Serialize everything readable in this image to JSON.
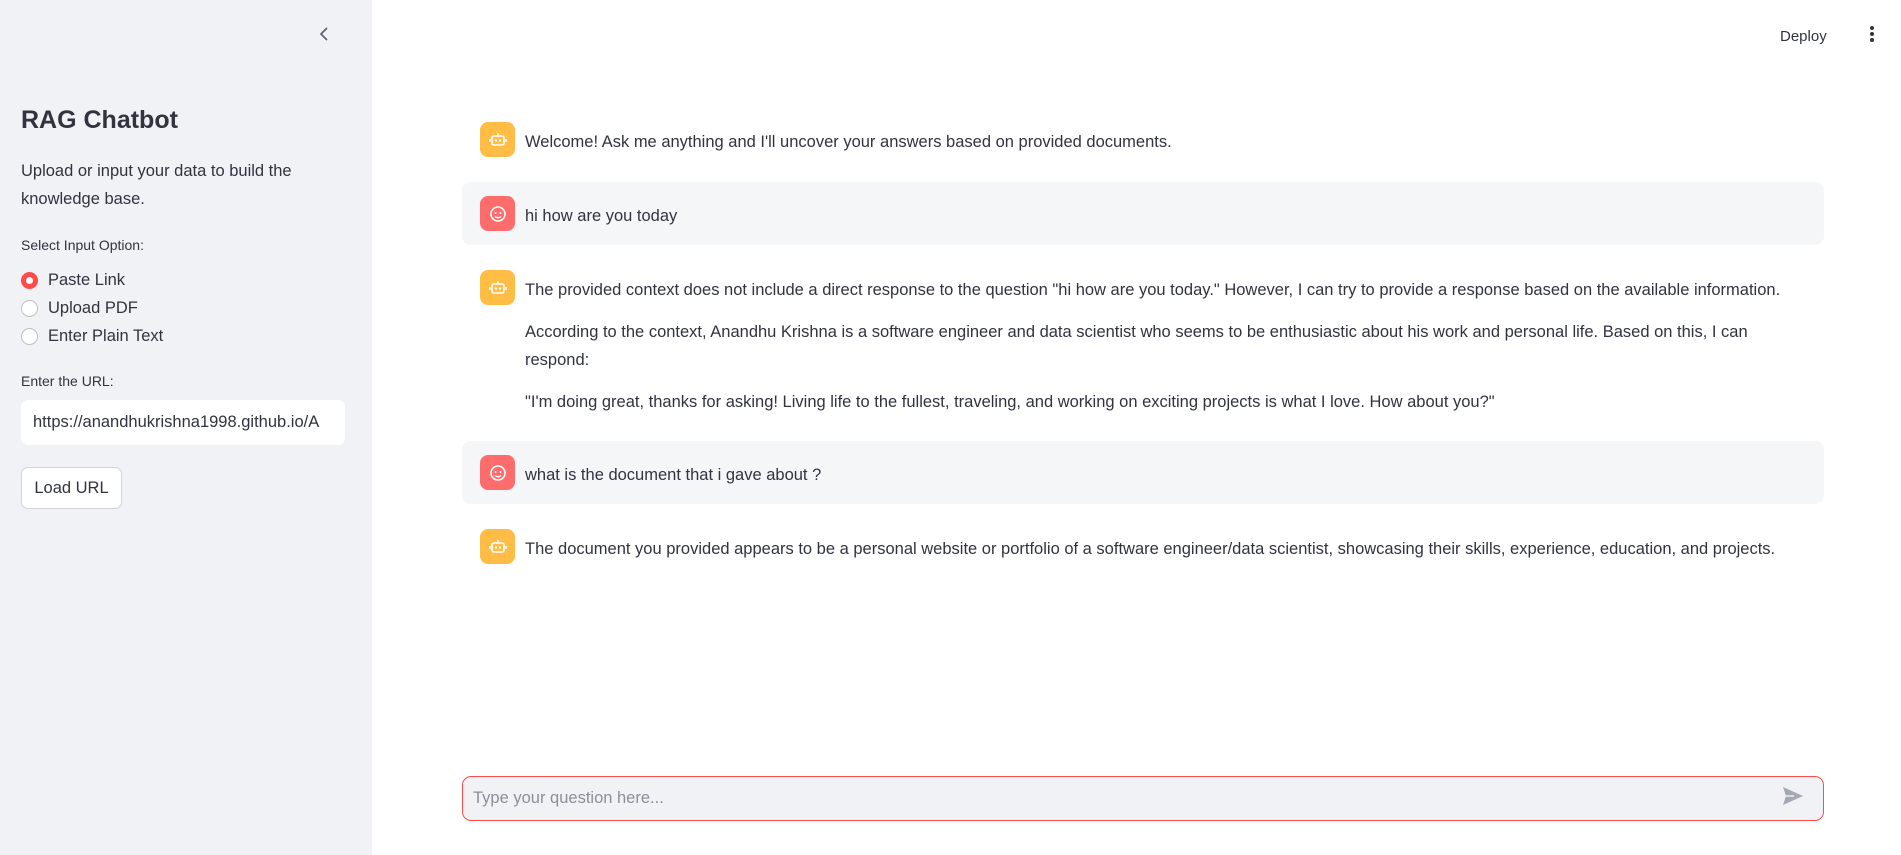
{
  "sidebar": {
    "title": "RAG Chatbot",
    "description": "Upload or input your data to build the knowledge base.",
    "input_option_label": "Select Input Option:",
    "options": [
      {
        "label": "Paste Link",
        "selected": true
      },
      {
        "label": "Upload PDF",
        "selected": false
      },
      {
        "label": "Enter Plain Text",
        "selected": false
      }
    ],
    "url_label": "Enter the URL:",
    "url_value": "https://anandhukrishna1998.github.io/A",
    "load_button": "Load URL"
  },
  "header": {
    "deploy_label": "Deploy"
  },
  "messages": [
    {
      "role": "assistant",
      "paragraphs": [
        "Welcome! Ask me anything and I'll uncover your answers based on provided documents."
      ]
    },
    {
      "role": "user",
      "paragraphs": [
        "hi how are you today"
      ]
    },
    {
      "role": "assistant",
      "paragraphs": [
        "The provided context does not include a direct response to the question \"hi how are you today.\" However, I can try to provide a response based on the available information.",
        "According to the context, Anandhu Krishna is a software engineer and data scientist who seems to be enthusiastic about his work and personal life. Based on this, I can respond:",
        "\"I'm doing great, thanks for asking! Living life to the fullest, traveling, and working on exciting projects is what I love. How about you?\""
      ]
    },
    {
      "role": "user",
      "paragraphs": [
        "what is the document that i gave about ?"
      ]
    },
    {
      "role": "assistant",
      "paragraphs": [
        "The document you provided appears to be a personal website or portfolio of a software engineer/data scientist, showcasing their skills, experience, education, and projects."
      ]
    }
  ],
  "chat_input": {
    "placeholder": "Type your question here...",
    "value": ""
  },
  "colors": {
    "sidebar_bg": "#f0f2f6",
    "accent": "#ff4b4b",
    "bot_avatar": "#ffbd45",
    "user_avatar": "#ff6c6c",
    "user_message_bg": "#f5f6f8"
  },
  "icons": {
    "collapse": "chevron-left-icon",
    "menu": "more-vertical-icon",
    "bot_avatar": "robot-icon",
    "user_avatar": "smiley-face-icon",
    "send": "send-icon"
  }
}
